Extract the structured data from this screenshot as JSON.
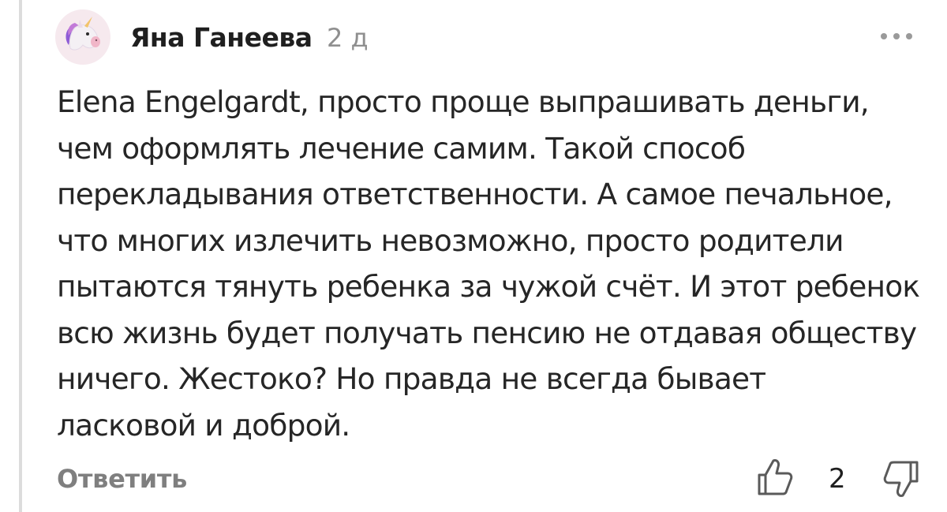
{
  "comment": {
    "author": "Яна Ганеева",
    "time": "2 д",
    "text": "Elena Engelgardt, просто проще выпрашивать деньги,\nчем оформлять лечение самим. Такой способ\nперекладывания ответственности. А самое печальное,\nчто многих излечить невозможно, просто родители\nпытаются тянуть ребенка за чужой счёт. И этот ребенок\nвсю жизнь будет получать пенсию не отдавая обществу\nничего. Жестоко? Но правда не всегда бывает\nласковой и доброй.",
    "reply_label": "Ответить",
    "likes": "2"
  },
  "icons": {
    "avatar": "unicorn-avatar-icon",
    "more": "more-dots-icon",
    "like": "thumbs-up-icon",
    "dislike": "thumbs-down-icon"
  },
  "colors": {
    "text": "#262626",
    "muted": "#8f8f8f",
    "rail": "#dcdcdc",
    "avatar_bg": "#f6e9ee"
  }
}
